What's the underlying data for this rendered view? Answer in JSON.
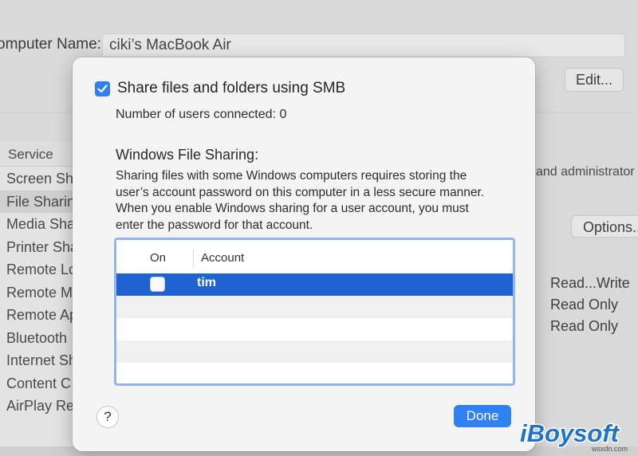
{
  "background": {
    "computer_name_label": "omputer Name:",
    "computer_name_value": "ciki’s MacBook Air",
    "edit_button": "Edit...",
    "service_header": "Service",
    "services": [
      {
        "label": "Screen Sh"
      },
      {
        "label": "File Sharin"
      },
      {
        "label": "Media Sha"
      },
      {
        "label": "Printer Sha"
      },
      {
        "label": "Remote Lo"
      },
      {
        "label": "Remote Ma"
      },
      {
        "label": "Remote Ap"
      },
      {
        "label": "Bluetooth"
      },
      {
        "label": "Internet Sh"
      },
      {
        "label": "Content C"
      },
      {
        "label": "AirPlay Re"
      }
    ],
    "admin_text": "and administrator",
    "options_button": "Options...",
    "permissions": [
      "Read...Write",
      "Read Only",
      "Read Only"
    ]
  },
  "sheet": {
    "smb_checkbox_label": "Share files and folders using SMB",
    "smb_checked": true,
    "users_connected": "Number of users connected: 0",
    "windows_title": "Windows File Sharing:",
    "windows_description": "Sharing files with some Windows computers requires storing the user’s account password on this computer in a less secure manner. When you enable Windows sharing for a user account, you must enter the password for that account.",
    "table": {
      "columns": [
        "On",
        "Account"
      ],
      "rows": [
        {
          "on": false,
          "account": "tim",
          "selected": true
        }
      ]
    },
    "help_button": "?",
    "done_button": "Done"
  },
  "watermark": {
    "text": "iBoysoft",
    "site": "wsxdn.com"
  },
  "colors": {
    "accent": "#2f80f0",
    "selection": "#1f63d2",
    "focus_ring": "#8fb6f2",
    "watermark": "#1e74c8"
  }
}
